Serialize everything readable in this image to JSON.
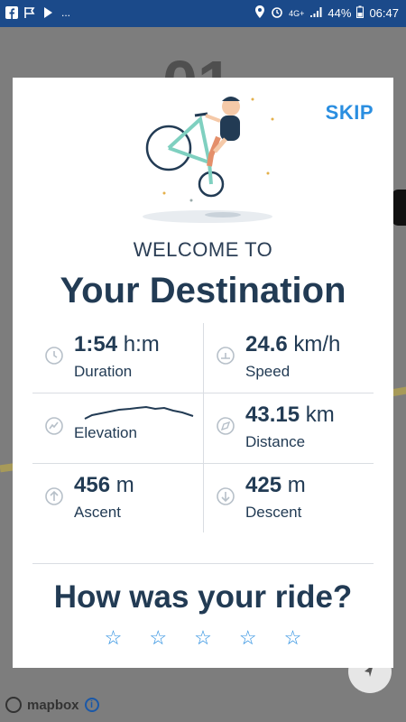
{
  "status_bar": {
    "battery": "44%",
    "time": "06:47",
    "network": "4G+",
    "more": "..."
  },
  "background": {
    "big_text": "01",
    "attribution": "mapbox",
    "info_icon": "i"
  },
  "card": {
    "skip_label": "SKIP",
    "welcome": "WELCOME TO",
    "destination": "Your Destination",
    "stats": {
      "duration": {
        "value": "1:54",
        "unit": "h:m",
        "label": "Duration"
      },
      "speed": {
        "value": "24.6",
        "unit": "km/h",
        "label": "Speed"
      },
      "elevation": {
        "label": "Elevation"
      },
      "distance": {
        "value": "43.15",
        "unit": "km",
        "label": "Distance"
      },
      "ascent": {
        "value": "456",
        "unit": "m",
        "label": "Ascent"
      },
      "descent": {
        "value": "425",
        "unit": "m",
        "label": "Descent"
      }
    },
    "question": "How was your ride?",
    "stars": [
      "☆",
      "☆",
      "☆",
      "☆",
      "☆"
    ]
  },
  "colors": {
    "accent": "#2a8ee0",
    "text": "#223b54",
    "status_bar": "#1b4a8a"
  }
}
